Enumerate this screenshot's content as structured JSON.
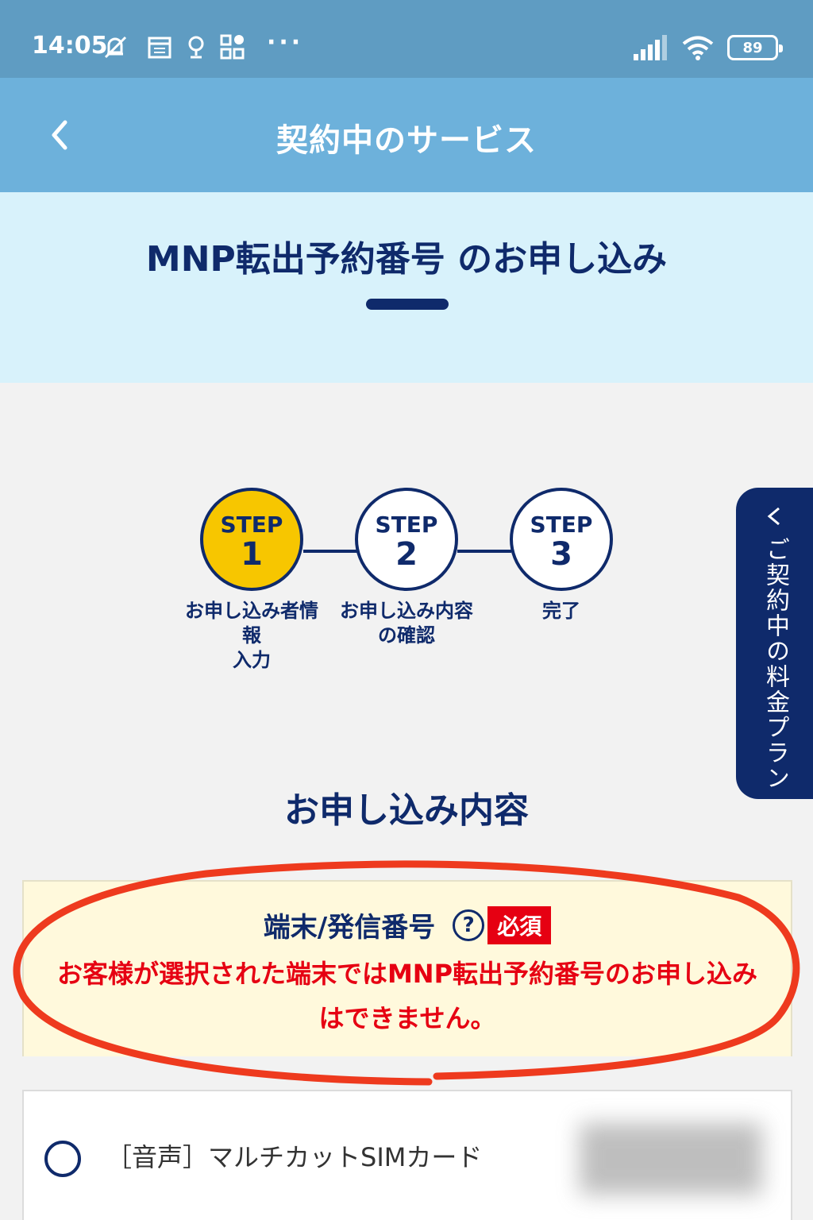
{
  "status_bar": {
    "time": "14:05",
    "battery": "89",
    "icons": [
      "mute-icon",
      "calendar-icon",
      "location-icon",
      "widgets-icon",
      "signal-icon",
      "wifi-icon",
      "battery-icon"
    ]
  },
  "header": {
    "title": "契約中のサービス",
    "back_icon": "chevron-left-icon"
  },
  "page": {
    "title": "MNP転出予約番号 のお申し込み"
  },
  "steps": [
    {
      "label": "STEP",
      "number": "1",
      "caption_line1": "お申し込み者情",
      "caption_line2": "報",
      "caption_line3": "入力",
      "active": true
    },
    {
      "label": "STEP",
      "number": "2",
      "caption_line1": "お申し込み内容",
      "caption_line2": "の確認",
      "active": false
    },
    {
      "label": "STEP",
      "number": "3",
      "caption_line1": "完了",
      "active": false
    }
  ],
  "side_tab": {
    "label": "ご契約中の料金プラン"
  },
  "section": {
    "heading": "お申し込み内容"
  },
  "field": {
    "label": "端末/発信番号",
    "help": "?",
    "required": "必須",
    "error": "お客様が選択された端末ではMNP転出予約番号のお申し込みはできません。"
  },
  "options": [
    {
      "label": "［音声］マルチカットSIMカード"
    }
  ],
  "colors": {
    "status_bar": "#5f9cc2",
    "header": "#6db1db",
    "title_band": "#d8f2fb",
    "navy": "#0f2a6b",
    "active_step": "#f7c600",
    "error_red": "#e60012",
    "annotation_red": "#ee3a1e"
  }
}
